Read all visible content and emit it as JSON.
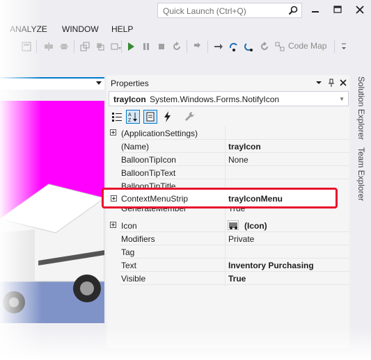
{
  "quick_launch": {
    "placeholder": "Quick Launch (Ctrl+Q)"
  },
  "menu": {
    "items": [
      "ANALYZE",
      "WINDOW",
      "HELP"
    ]
  },
  "toolbar": {
    "code_map_label": "Code Map"
  },
  "properties": {
    "title": "Properties",
    "selected_object": {
      "name": "trayIcon",
      "type": "System.Windows.Forms.NotifyIcon"
    },
    "rows": [
      {
        "name": "(ApplicationSettings)",
        "value": "",
        "expandable": true,
        "bold": false
      },
      {
        "name": "(Name)",
        "value": "trayIcon",
        "expandable": false,
        "bold": true
      },
      {
        "name": "BalloonTipIcon",
        "value": "None",
        "expandable": false,
        "bold": false
      },
      {
        "name": "BalloonTipText",
        "value": "",
        "expandable": false,
        "bold": false
      },
      {
        "name": "BalloonTipTitle",
        "value": "",
        "expandable": false,
        "bold": false
      },
      {
        "name": "ContextMenuStrip",
        "value": "trayIconMenu",
        "expandable": true,
        "bold": true
      },
      {
        "name": "GenerateMember",
        "value": "True",
        "expandable": false,
        "bold": false
      },
      {
        "name": "Icon",
        "value": "(Icon)",
        "expandable": true,
        "bold": true
      },
      {
        "name": "Modifiers",
        "value": "Private",
        "expandable": false,
        "bold": false
      },
      {
        "name": "Tag",
        "value": "",
        "expandable": false,
        "bold": false
      },
      {
        "name": "Text",
        "value": "Inventory Purchasing",
        "expandable": false,
        "bold": true
      },
      {
        "name": "Visible",
        "value": "True",
        "expandable": false,
        "bold": true
      }
    ]
  },
  "side_tabs": {
    "solution_explorer": "Solution Explorer",
    "team_explorer": "Team Explorer"
  },
  "colors": {
    "highlight": "#e8112d",
    "accent": "#007acc",
    "designer_magenta": "#ff00ff"
  },
  "icons": [
    "search-icon",
    "minimize-icon",
    "maximize-icon",
    "close-icon",
    "start-icon",
    "pause-icon",
    "stop-icon",
    "restart-icon",
    "pin-icon",
    "wrench-icon",
    "lightning-icon"
  ]
}
